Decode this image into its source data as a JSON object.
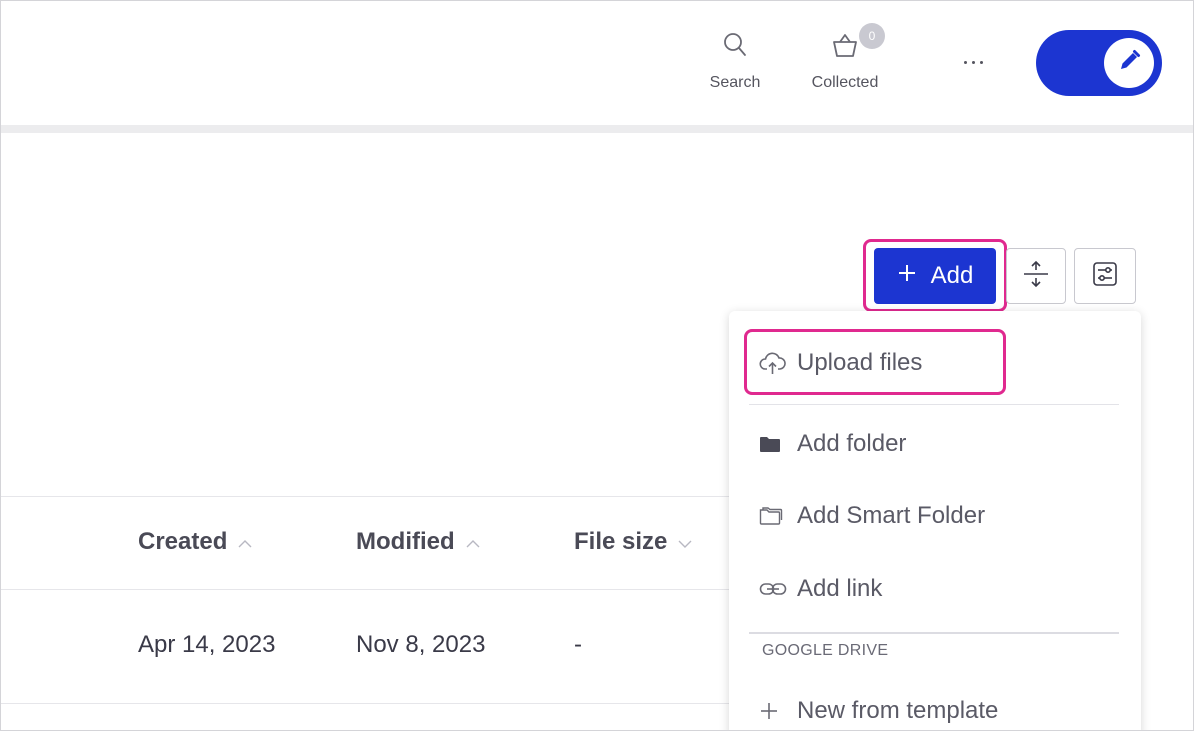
{
  "header": {
    "search_label": "Search",
    "collected_label": "Collected",
    "collected_count": "0",
    "more_label": "More options",
    "edit_label": "Edit mode"
  },
  "toolbar": {
    "add_label": "Add",
    "expand_icon": "expand-vertical-icon",
    "filter_icon": "filter-settings-icon"
  },
  "table": {
    "columns": [
      {
        "label": "Created",
        "sort": "ascending"
      },
      {
        "label": "Modified",
        "sort": "ascending"
      },
      {
        "label": "File size",
        "sort": "descending"
      }
    ],
    "rows": [
      {
        "created": "Apr 14, 2023",
        "modified": "Nov 8, 2023",
        "file_size": "-"
      }
    ]
  },
  "add_menu": {
    "items": [
      {
        "label": "Upload files",
        "icon": "cloud-upload-icon"
      },
      {
        "label": "Add folder",
        "icon": "folder-icon"
      },
      {
        "label": "Add Smart Folder",
        "icon": "smart-folder-icon"
      },
      {
        "label": "Add link",
        "icon": "link-icon"
      }
    ],
    "section_title": "GOOGLE DRIVE",
    "section_items": [
      {
        "label": "New from template",
        "icon": "plus-icon"
      }
    ]
  },
  "colors": {
    "accent": "#1c35d1",
    "highlight": "#e0298f",
    "badge": "#c9c9d1"
  }
}
